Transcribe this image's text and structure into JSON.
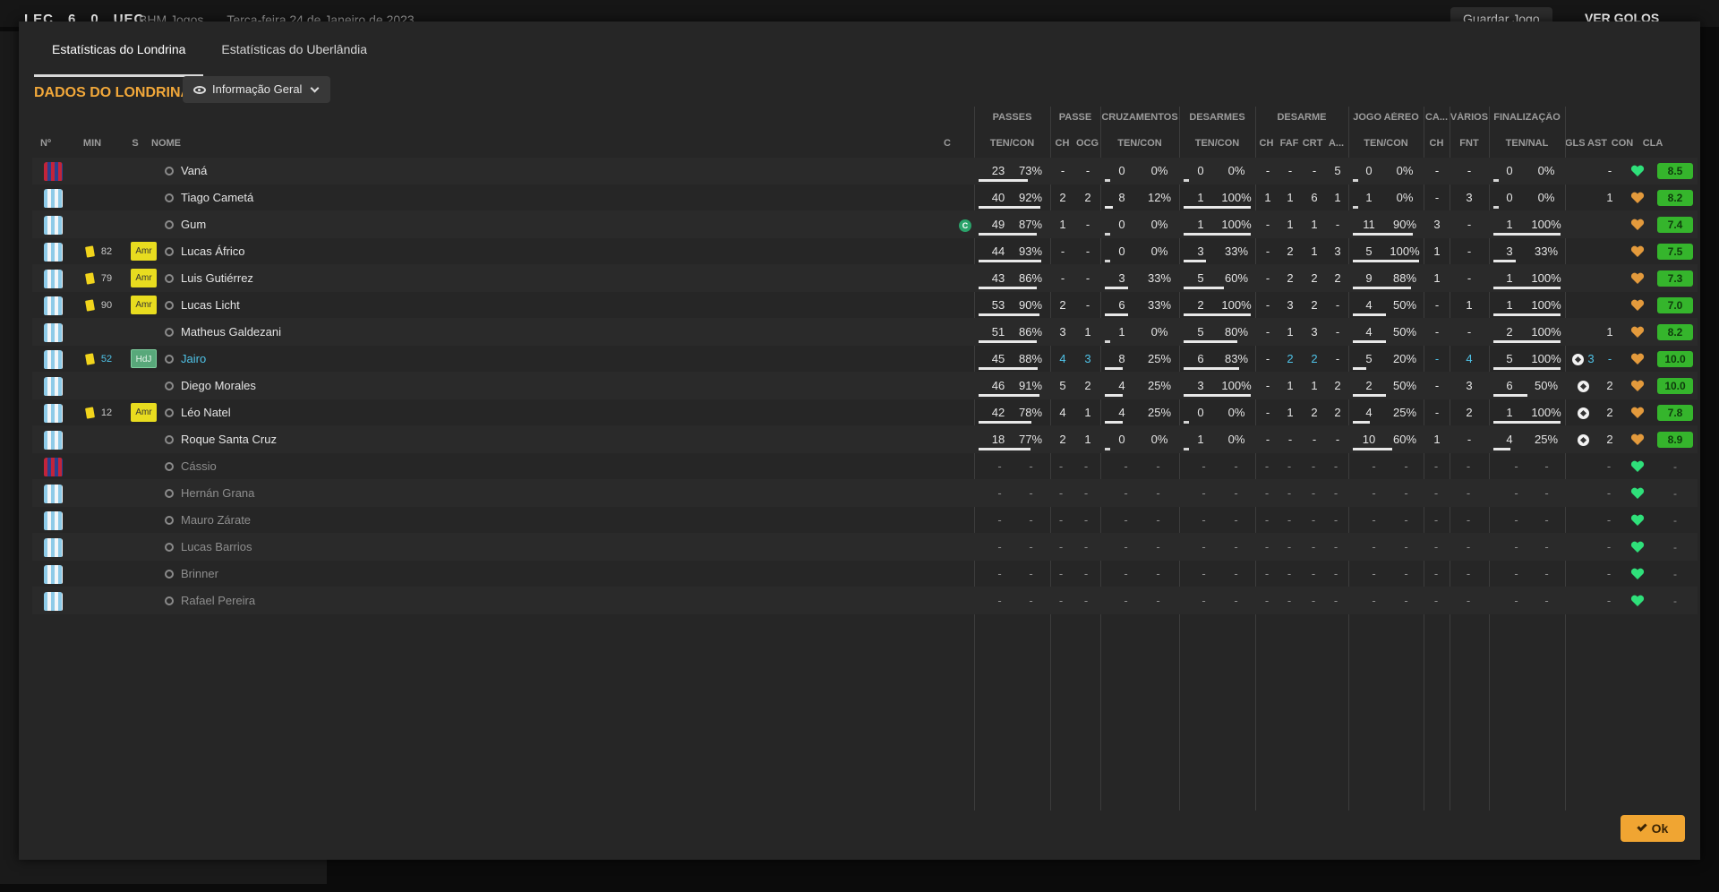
{
  "topbar": {
    "home_abbr": "LEC",
    "home_score": "6",
    "away_score": "0",
    "away_abbr": "UEC",
    "context": "BHM Jogos",
    "date": "Terça-feira 24 de Janeiro de 2023",
    "save_label": "Guardar Jogo",
    "goals_label": "VER GOLOS"
  },
  "tabs": [
    "Estatísticas do Londrina",
    "Estatísticas do Uberlândia"
  ],
  "section_title": "DADOS DO LONDRINA",
  "view_select": "Informação Geral",
  "groups": [
    "PASSES",
    "PASSE",
    "CRUZAMENTOS",
    "DESARMES",
    "DESARME",
    "JOGO AÉREO",
    "CA...",
    "VÁRIOS",
    "FINALIZAÇÃO"
  ],
  "columns": {
    "no": "Nº",
    "min": "MIN",
    "s": "S",
    "name": "NOME",
    "c": "C",
    "passes": "TEN/CON",
    "ch": "CH",
    "ocg": "OCG",
    "cross": "TEN/CON",
    "tackles": "TEN/CON",
    "d_ch": "CH",
    "faf": "FAF",
    "crt": "CRT",
    "a": "A...",
    "aerial": "TEN/CON",
    "ca_ch": "CH",
    "fnt": "FNT",
    "shots": "TEN/NAL",
    "gls": "GLS",
    "ast": "AST",
    "con": "CON",
    "cla": "CLA"
  },
  "players": [
    {
      "shirt": "keeper",
      "card": false,
      "min": "",
      "pos": "",
      "name": "Vaná",
      "captain": false,
      "p1": "23",
      "p2": "73%",
      "pass_pct": 73,
      "ch": "-",
      "ocg": "-",
      "c1": "0",
      "c2": "0%",
      "cross_pct": 0,
      "t1": "0",
      "t2": "0%",
      "tack_pct": 0,
      "dch": "-",
      "faf": "-",
      "crt": "-",
      "a": "5",
      "a1": "0",
      "a2": "0%",
      "air_pct": 0,
      "cach": "-",
      "fnt": "-",
      "s1": "0",
      "s2": "0%",
      "shot_pct": 0,
      "gls": "",
      "gls_ball": false,
      "ast": "-",
      "heart": "green",
      "rating": "8.5"
    },
    {
      "shirt": "outfield",
      "card": false,
      "min": "",
      "pos": "",
      "name": "Tiago Cametá",
      "captain": false,
      "p1": "40",
      "p2": "92%",
      "pass_pct": 92,
      "ch": "2",
      "ocg": "2",
      "c1": "8",
      "c2": "12%",
      "cross_pct": 12,
      "t1": "1",
      "t2": "100%",
      "tack_pct": 100,
      "dch": "1",
      "faf": "1",
      "crt": "6",
      "a": "1",
      "a1": "1",
      "a2": "0%",
      "air_pct": 0,
      "cach": "-",
      "fnt": "3",
      "s1": "0",
      "s2": "0%",
      "shot_pct": 0,
      "gls": "",
      "gls_ball": false,
      "ast": "1",
      "heart": "orange",
      "rating": "8.2"
    },
    {
      "shirt": "outfield",
      "card": false,
      "min": "",
      "pos": "",
      "name": "Gum",
      "captain": true,
      "p1": "49",
      "p2": "87%",
      "pass_pct": 87,
      "ch": "1",
      "ocg": "-",
      "c1": "0",
      "c2": "0%",
      "cross_pct": 0,
      "t1": "1",
      "t2": "100%",
      "tack_pct": 100,
      "dch": "-",
      "faf": "1",
      "crt": "1",
      "a": "-",
      "a1": "11",
      "a2": "90%",
      "air_pct": 90,
      "cach": "3",
      "fnt": "-",
      "s1": "1",
      "s2": "100%",
      "shot_pct": 100,
      "gls": "",
      "gls_ball": false,
      "ast": "",
      "heart": "orange",
      "rating": "7.4"
    },
    {
      "shirt": "outfield",
      "card": true,
      "min": "82",
      "pos": "Amr",
      "name": "Lucas Áfrico",
      "captain": false,
      "p1": "44",
      "p2": "93%",
      "pass_pct": 93,
      "ch": "-",
      "ocg": "-",
      "c1": "0",
      "c2": "0%",
      "cross_pct": 0,
      "t1": "3",
      "t2": "33%",
      "tack_pct": 33,
      "dch": "-",
      "faf": "2",
      "crt": "1",
      "a": "3",
      "a1": "5",
      "a2": "100%",
      "air_pct": 100,
      "cach": "1",
      "fnt": "-",
      "s1": "3",
      "s2": "33%",
      "shot_pct": 33,
      "gls": "",
      "gls_ball": false,
      "ast": "",
      "heart": "orange",
      "rating": "7.5"
    },
    {
      "shirt": "outfield",
      "card": true,
      "min": "79",
      "pos": "Amr",
      "name": "Luis Gutiérrez",
      "captain": false,
      "p1": "43",
      "p2": "86%",
      "pass_pct": 86,
      "ch": "-",
      "ocg": "-",
      "c1": "3",
      "c2": "33%",
      "cross_pct": 33,
      "t1": "5",
      "t2": "60%",
      "tack_pct": 60,
      "dch": "-",
      "faf": "2",
      "crt": "2",
      "a": "2",
      "a1": "9",
      "a2": "88%",
      "air_pct": 88,
      "cach": "1",
      "fnt": "-",
      "s1": "1",
      "s2": "100%",
      "shot_pct": 100,
      "gls": "",
      "gls_ball": false,
      "ast": "",
      "heart": "orange",
      "rating": "7.3"
    },
    {
      "shirt": "outfield",
      "card": true,
      "min": "90",
      "pos": "Amr",
      "name": "Lucas Licht",
      "captain": false,
      "p1": "53",
      "p2": "90%",
      "pass_pct": 90,
      "ch": "2",
      "ocg": "-",
      "c1": "6",
      "c2": "33%",
      "cross_pct": 33,
      "t1": "2",
      "t2": "100%",
      "tack_pct": 100,
      "dch": "-",
      "faf": "3",
      "crt": "2",
      "a": "-",
      "a1": "4",
      "a2": "50%",
      "air_pct": 50,
      "cach": "-",
      "fnt": "1",
      "s1": "1",
      "s2": "100%",
      "shot_pct": 100,
      "gls": "",
      "gls_ball": false,
      "ast": "",
      "heart": "orange",
      "rating": "7.0"
    },
    {
      "shirt": "outfield",
      "card": false,
      "min": "",
      "pos": "",
      "name": "Matheus Galdezani",
      "captain": false,
      "p1": "51",
      "p2": "86%",
      "pass_pct": 86,
      "ch": "3",
      "ocg": "1",
      "c1": "1",
      "c2": "0%",
      "cross_pct": 0,
      "t1": "5",
      "t2": "80%",
      "tack_pct": 80,
      "dch": "-",
      "faf": "1",
      "crt": "3",
      "a": "-",
      "a1": "4",
      "a2": "50%",
      "air_pct": 50,
      "cach": "-",
      "fnt": "-",
      "s1": "2",
      "s2": "100%",
      "shot_pct": 100,
      "gls": "",
      "gls_ball": false,
      "ast": "1",
      "heart": "orange",
      "rating": "8.2"
    },
    {
      "shirt": "outfield",
      "card": true,
      "min": "52",
      "pos": "HdJ",
      "name": "Jairo",
      "captain": false,
      "highlight": true,
      "p1": "45",
      "p2": "88%",
      "pass_pct": 88,
      "ch": "4",
      "ocg": "3",
      "c1": "8",
      "c2": "25%",
      "cross_pct": 25,
      "t1": "6",
      "t2": "83%",
      "tack_pct": 83,
      "dch": "-",
      "faf": "2",
      "crt": "2",
      "a": "-",
      "a1": "5",
      "a2": "20%",
      "air_pct": 20,
      "cach": "-",
      "fnt": "4",
      "s1": "5",
      "s2": "100%",
      "shot_pct": 100,
      "gls": "3",
      "gls_ball": true,
      "ast": "-",
      "heart": "orange",
      "rating": "10.0"
    },
    {
      "shirt": "outfield",
      "card": false,
      "min": "",
      "pos": "",
      "name": "Diego Morales",
      "captain": false,
      "p1": "46",
      "p2": "91%",
      "pass_pct": 91,
      "ch": "5",
      "ocg": "2",
      "c1": "4",
      "c2": "25%",
      "cross_pct": 25,
      "t1": "3",
      "t2": "100%",
      "tack_pct": 100,
      "dch": "-",
      "faf": "1",
      "crt": "1",
      "a": "2",
      "a1": "2",
      "a2": "50%",
      "air_pct": 50,
      "cach": "-",
      "fnt": "3",
      "s1": "6",
      "s2": "50%",
      "shot_pct": 50,
      "gls": "",
      "gls_ball": true,
      "ast": "2",
      "heart": "orange",
      "rating": "10.0"
    },
    {
      "shirt": "outfield",
      "card": true,
      "min": "12",
      "pos": "Amr",
      "name": "Léo Natel",
      "captain": false,
      "p1": "42",
      "p2": "78%",
      "pass_pct": 78,
      "ch": "4",
      "ocg": "1",
      "c1": "4",
      "c2": "25%",
      "cross_pct": 25,
      "t1": "0",
      "t2": "0%",
      "tack_pct": 0,
      "dch": "-",
      "faf": "1",
      "crt": "2",
      "a": "2",
      "a1": "4",
      "a2": "25%",
      "air_pct": 25,
      "cach": "-",
      "fnt": "2",
      "s1": "1",
      "s2": "100%",
      "shot_pct": 100,
      "gls": "",
      "gls_ball": true,
      "ast": "2",
      "heart": "orange",
      "rating": "7.8"
    },
    {
      "shirt": "outfield",
      "card": false,
      "min": "",
      "pos": "",
      "name": "Roque Santa Cruz",
      "captain": false,
      "p1": "18",
      "p2": "77%",
      "pass_pct": 77,
      "ch": "2",
      "ocg": "1",
      "c1": "0",
      "c2": "0%",
      "cross_pct": 0,
      "t1": "1",
      "t2": "0%",
      "tack_pct": 0,
      "dch": "-",
      "faf": "-",
      "crt": "-",
      "a": "-",
      "a1": "10",
      "a2": "60%",
      "air_pct": 60,
      "cach": "1",
      "fnt": "-",
      "s1": "4",
      "s2": "25%",
      "shot_pct": 25,
      "gls": "",
      "gls_ball": true,
      "ast": "2",
      "heart": "orange",
      "rating": "8.9"
    },
    {
      "shirt": "keeper",
      "sub": true,
      "name": "Cássio",
      "heart": "green"
    },
    {
      "shirt": "outfield",
      "sub": true,
      "name": "Hernán Grana",
      "heart": "green"
    },
    {
      "shirt": "outfield",
      "sub": true,
      "name": "Mauro Zárate",
      "heart": "green"
    },
    {
      "shirt": "outfield",
      "sub": true,
      "name": "Lucas Barrios",
      "heart": "green"
    },
    {
      "shirt": "outfield",
      "sub": true,
      "name": "Brinner",
      "heart": "green"
    },
    {
      "shirt": "outfield",
      "sub": true,
      "name": "Rafael Pereira",
      "heart": "green"
    }
  ],
  "ok_label": "Ok",
  "colors": {
    "accent": "#f0a532",
    "rating_green": "#35b52c",
    "highlight": "#4fc3e8"
  }
}
